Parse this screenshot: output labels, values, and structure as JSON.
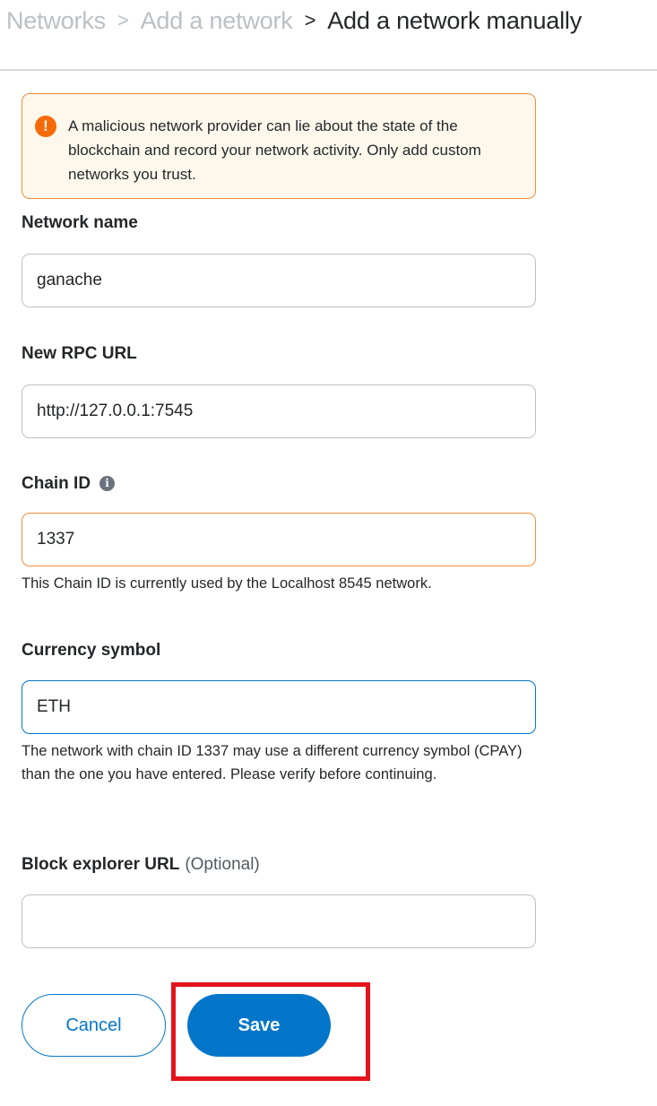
{
  "breadcrumb": {
    "items": [
      "Networks",
      "Add a network",
      "Add a network manually"
    ],
    "separator": ">"
  },
  "warning": {
    "icon": "exclamation-icon",
    "icon_glyph": "!",
    "text": "A malicious network provider can lie about the state of the blockchain and record your network activity. Only add custom networks you trust."
  },
  "fields": {
    "network_name": {
      "label": "Network name",
      "value": "ganache"
    },
    "rpc_url": {
      "label": "New RPC URL",
      "value": "http://127.0.0.1:7545"
    },
    "chain_id": {
      "label": "Chain ID",
      "info_icon": "info-icon",
      "info_glyph": "i",
      "value": "1337",
      "helper": "This Chain ID is currently used by the Localhost 8545 network."
    },
    "currency_symbol": {
      "label": "Currency symbol",
      "value": "ETH",
      "helper": "The network with chain ID 1337 may use a different currency symbol (CPAY) than the one you have entered. Please verify before continuing."
    },
    "block_explorer": {
      "label": "Block explorer URL",
      "optional": "(Optional)",
      "value": ""
    }
  },
  "actions": {
    "cancel_label": "Cancel",
    "save_label": "Save"
  },
  "colors": {
    "primary": "#0376c9",
    "warning_border": "#f08c3a",
    "warning_bg": "#fef8ec",
    "highlight": "#e3141d"
  }
}
